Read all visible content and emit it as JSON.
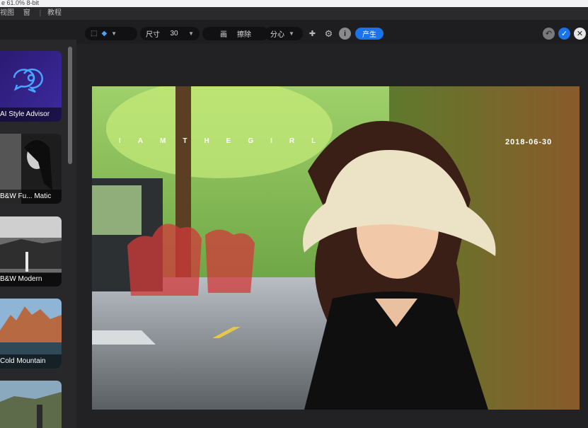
{
  "title_strip": "e 61.0% 8-bit",
  "menu": {
    "items": [
      "视图",
      "窗"
    ],
    "last": "教程"
  },
  "toolbar": {
    "size_label": "尺寸",
    "size_value": "30",
    "mode_label": "擦除",
    "mode_prefix": "画",
    "segment_label": "分心",
    "apply_label": "产生"
  },
  "sidebar": {
    "cards": [
      {
        "label": "AI Style Advisor"
      },
      {
        "label": "B&W Fu... Matic"
      },
      {
        "label": "B&W Modern"
      },
      {
        "label": "Cold Mountain"
      }
    ]
  },
  "photo": {
    "overlay_text": "IAMTHEGIRL",
    "date": "2018-06-30"
  },
  "colors": {
    "accent": "#1a73e8",
    "mask": "#d23a3a"
  }
}
